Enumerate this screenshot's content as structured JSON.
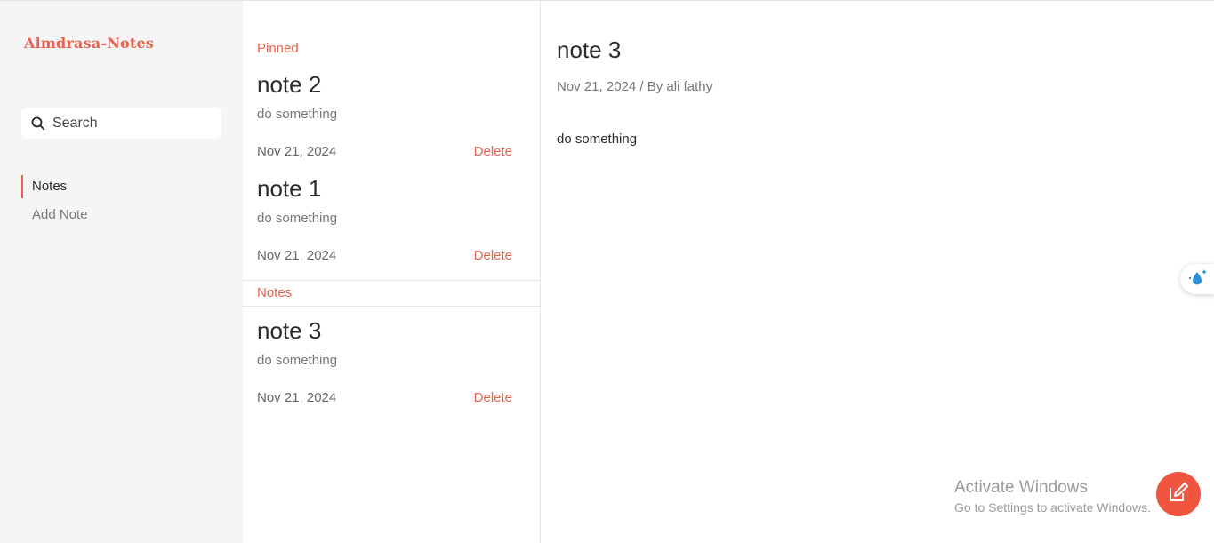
{
  "app": {
    "brand": "Almdrasa-Notes"
  },
  "sidebar": {
    "search": {
      "placeholder": "Search",
      "value": ""
    },
    "nav": [
      {
        "label": "Notes",
        "active": true
      },
      {
        "label": "Add Note",
        "active": false
      }
    ]
  },
  "list": {
    "pinned_label": "Pinned",
    "notes_label": "Notes",
    "pinned": [
      {
        "title": "note 2",
        "body": "do something",
        "date": "Nov 21, 2024",
        "delete_label": "Delete"
      },
      {
        "title": "note 1",
        "body": "do something",
        "date": "Nov 21, 2024",
        "delete_label": "Delete"
      }
    ],
    "notes": [
      {
        "title": "note 3",
        "body": "do something",
        "date": "Nov 21, 2024",
        "delete_label": "Delete"
      }
    ]
  },
  "detail": {
    "title": "note 3",
    "meta": "Nov 21, 2024 / By ali fathy",
    "body": "do something"
  },
  "watermark": {
    "line1": "Activate Windows",
    "line2": "Go to Settings to activate Windows."
  },
  "colors": {
    "accent": "#e8624e",
    "fab": "#f0553f",
    "sidebar_bg": "#f5f5f5",
    "drop_blue": "#2a8fd6"
  },
  "icons": {
    "search": "search-icon",
    "fab": "edit-pencil-icon",
    "widget": "water-drop-sparkle-icon"
  }
}
